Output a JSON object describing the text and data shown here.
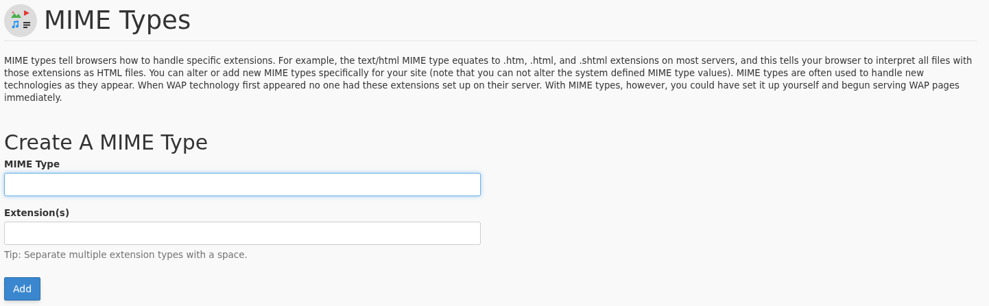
{
  "page_title": "MIME Types",
  "description": "MIME types tell browsers how to handle specific extensions. For example, the text/html MIME type equates to .htm, .html, and .shtml extensions on most servers, and this tells your browser to interpret all files with those extensions as HTML files. You can alter or add new MIME types specifically for your site (note that you can not alter the system defined MIME type values). MIME types are often used to handle new technologies as they appear. When WAP technology first appeared no one had these extensions set up on their server. With MIME types, however, you could have set it up yourself and begun serving WAP pages immediately.",
  "form": {
    "heading": "Create A MIME Type",
    "fields": [
      {
        "label": "MIME Type",
        "focused": true
      },
      {
        "label": "Extension(s)",
        "focused": false,
        "tip": "Tip: Separate multiple extension types with a space."
      }
    ],
    "submit_button": "Add"
  }
}
